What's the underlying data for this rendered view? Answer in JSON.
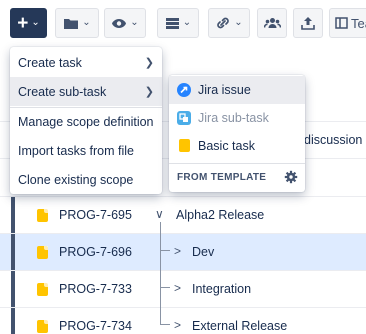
{
  "toolbar": {
    "add_button": "+",
    "view_label": "Tea"
  },
  "context_menu": {
    "items": [
      {
        "label": "Create task",
        "has_submenu": true
      },
      {
        "label": "Create sub-task",
        "has_submenu": true
      },
      {
        "label": "Manage scope definition",
        "has_submenu": false
      },
      {
        "label": "Import tasks from file",
        "has_submenu": false
      },
      {
        "label": "Clone existing scope",
        "has_submenu": false
      }
    ]
  },
  "submenu": {
    "items": [
      {
        "label": "Jira issue",
        "icon": "jira-icon"
      },
      {
        "label": "Jira sub-task",
        "icon": "jira-subtask-icon"
      },
      {
        "label": "Basic task",
        "icon": "basic-task-icon"
      }
    ],
    "template_header": "FROM TEMPLATE"
  },
  "background": {
    "partial_text": "discussion"
  },
  "tree": {
    "rows": [
      {
        "key": "PROG-7-695",
        "toggle": "∨",
        "name": "Alpha2 Release"
      },
      {
        "key": "PROG-7-696",
        "toggle": ">",
        "name": "Dev"
      },
      {
        "key": "PROG-7-733",
        "toggle": ">",
        "name": "Integration"
      },
      {
        "key": "PROG-7-734",
        "toggle": ">",
        "name": "External Release"
      }
    ]
  },
  "colors": {
    "primary": "#253858",
    "selected_row": "#deebff",
    "task_icon": "#ffc400",
    "jira_blue": "#2684ff"
  }
}
